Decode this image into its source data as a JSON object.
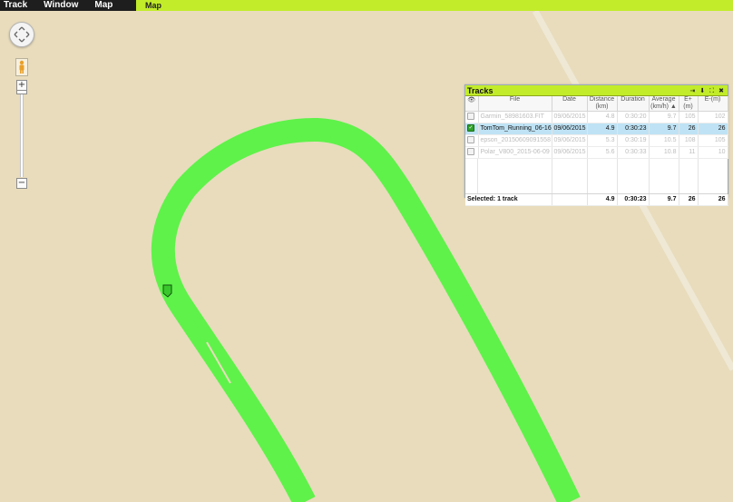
{
  "menu": {
    "items": [
      "Track",
      "Window",
      "Map"
    ]
  },
  "tab": {
    "label": "Map"
  },
  "map": {
    "route_color": "#5ff24a",
    "road_color": "#efe8d4"
  },
  "controls": {
    "zoom_in": "+",
    "zoom_out": "−"
  },
  "tracks_panel": {
    "title": "Tracks",
    "buttons": [
      "⇥",
      "⬇",
      "⛶",
      "✖"
    ],
    "columns": {
      "eye": "👁",
      "file": "File",
      "date": "Date",
      "distance": "Distance (km)",
      "duration": "Duration",
      "average": "Average (km/h) ▲",
      "eplus": "E+(m)",
      "eminus": "E-(m)"
    },
    "rows": [
      {
        "checked": false,
        "file": "Garmin_58981603.FIT",
        "date": "09/06/2015",
        "distance": "4.8",
        "duration": "0:30:20",
        "average": "9.7",
        "eplus": "105",
        "eminus": "102"
      },
      {
        "checked": true,
        "file": "TomTom_Running_06-16",
        "date": "09/06/2015",
        "distance": "4.9",
        "duration": "0:30:23",
        "average": "9.7",
        "eplus": "26",
        "eminus": "26"
      },
      {
        "checked": false,
        "file": "epson_20150609091558",
        "date": "09/06/2015",
        "distance": "5.3",
        "duration": "0:30:19",
        "average": "10.5",
        "eplus": "108",
        "eminus": "105"
      },
      {
        "checked": false,
        "file": "Polar_V800_2015-06-09",
        "date": "09/06/2015",
        "distance": "5.6",
        "duration": "0:30:33",
        "average": "10.8",
        "eplus": "11",
        "eminus": "10"
      }
    ],
    "summary": {
      "label": "Selected: 1 track",
      "distance": "4.9",
      "duration": "0:30:23",
      "average": "9.7",
      "eplus": "26",
      "eminus": "26"
    }
  }
}
